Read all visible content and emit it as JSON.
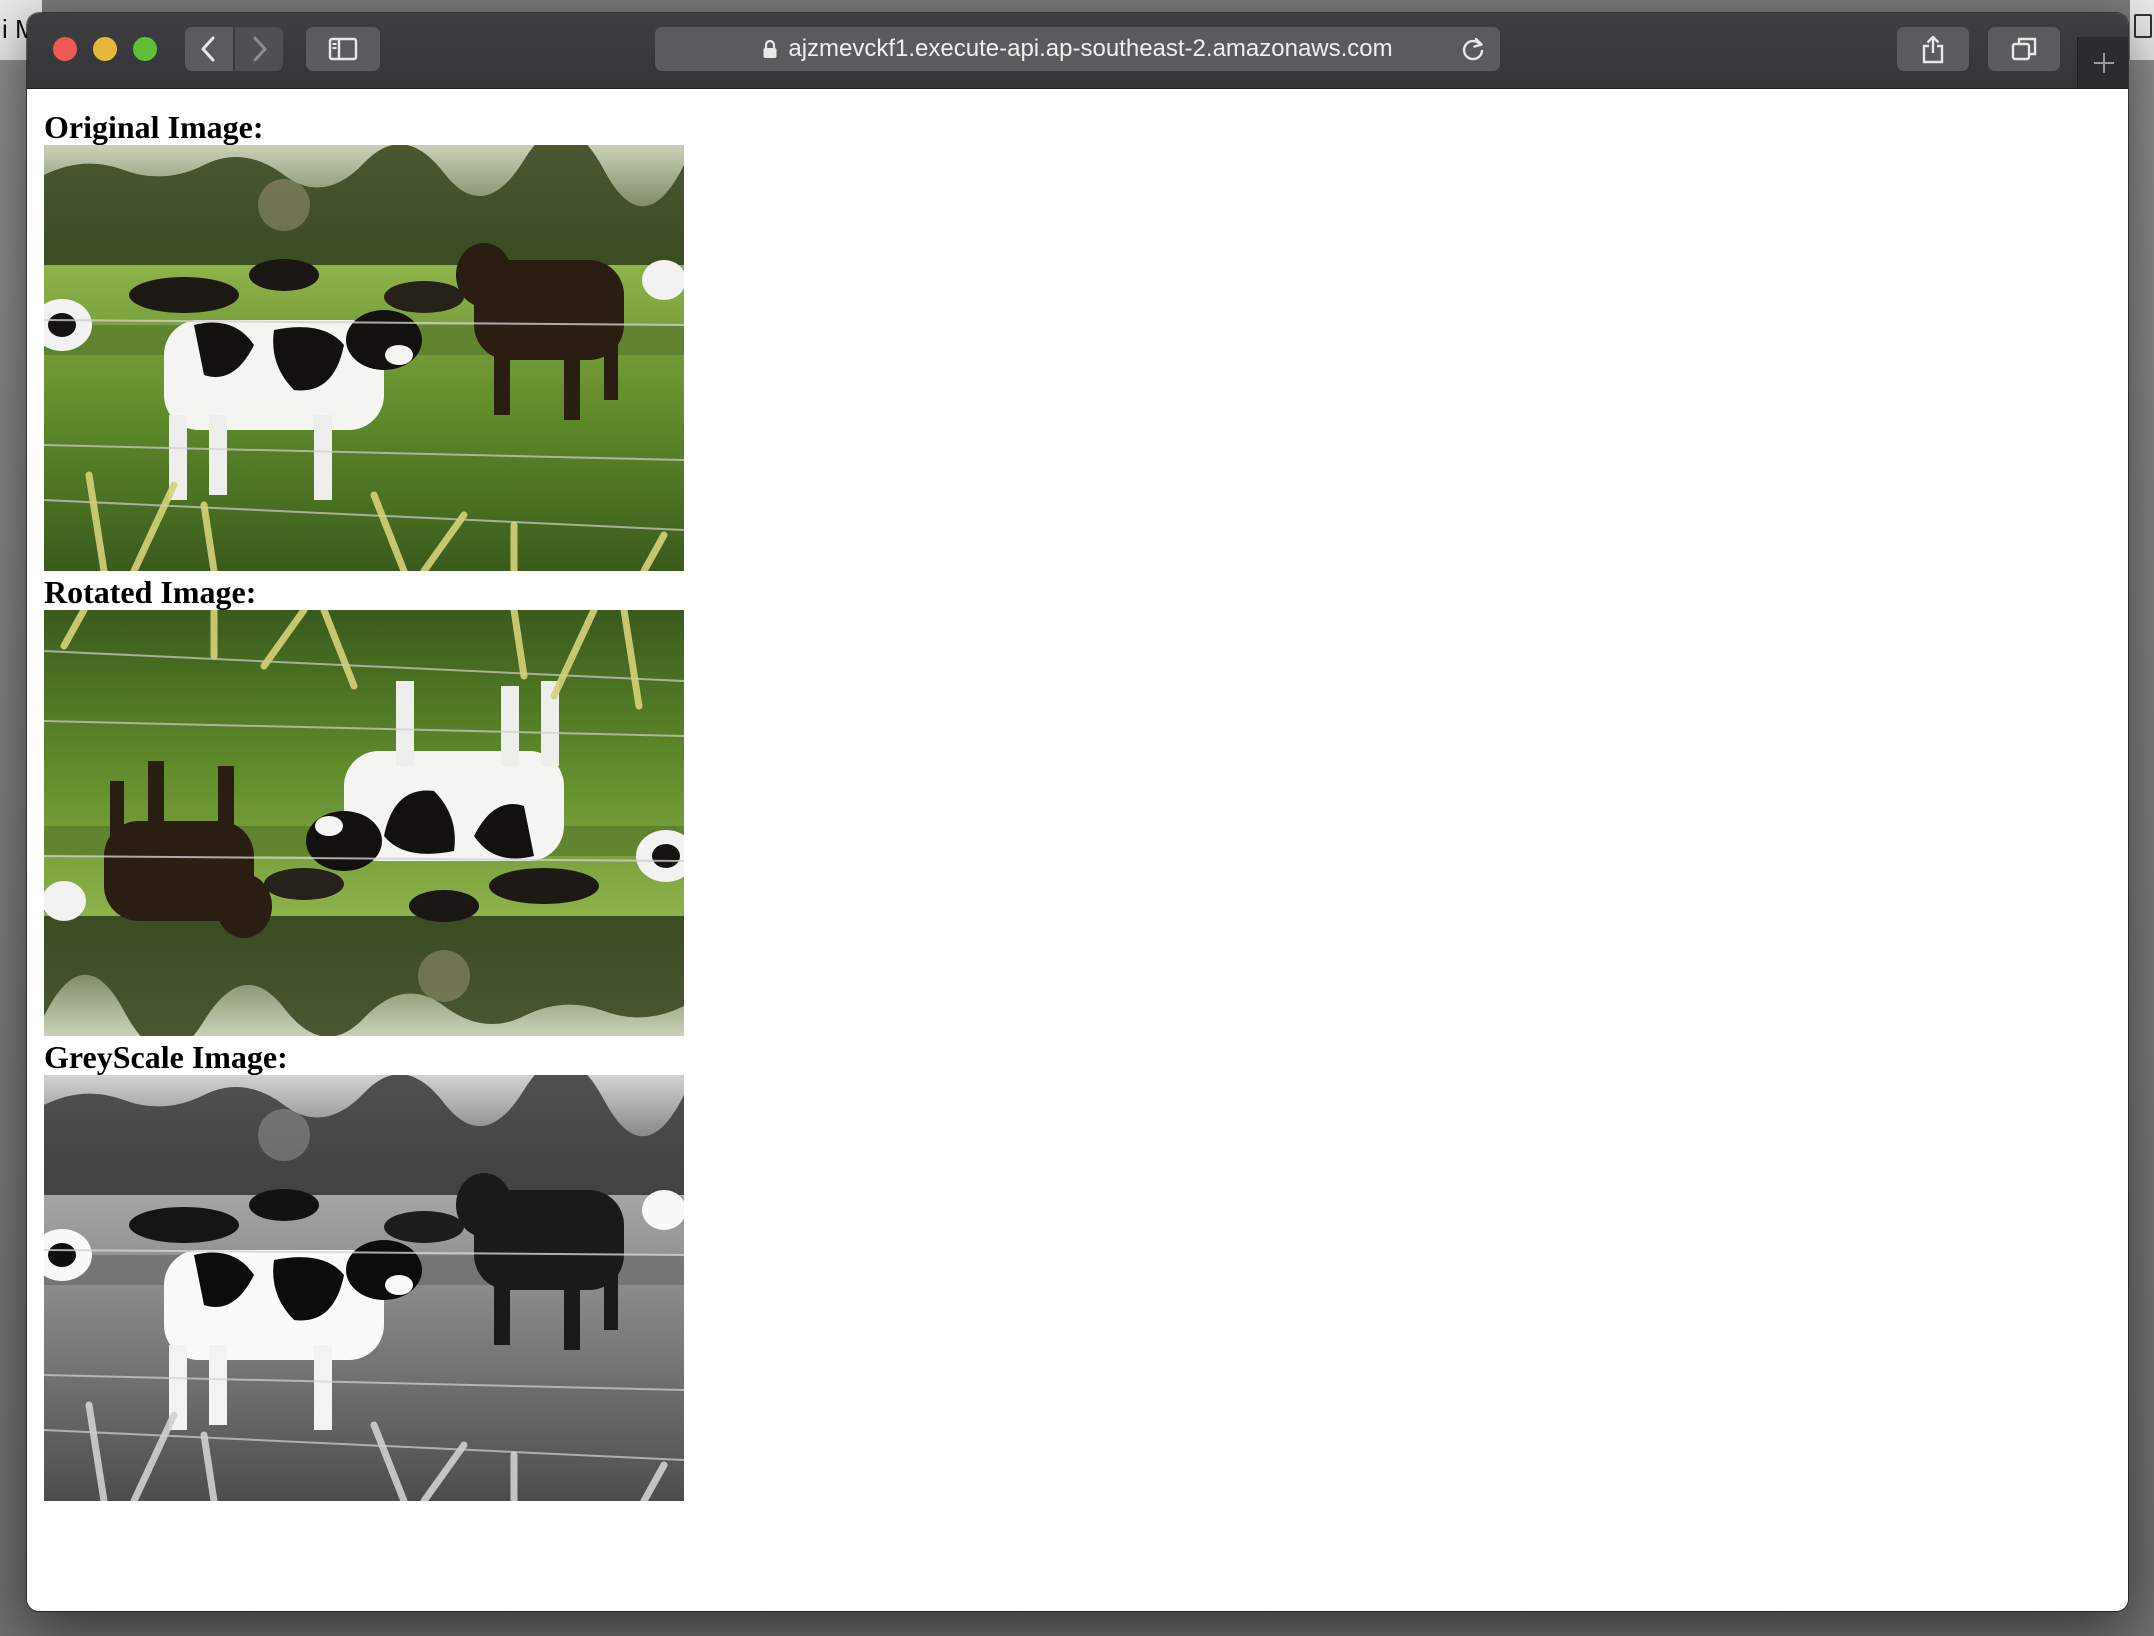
{
  "browser": {
    "url": "ajzmevckf1.execute-api.ap-southeast-2.amazonaws.com",
    "desktop_partial_text": "i M"
  },
  "page": {
    "sections": [
      {
        "title": "Original Image:"
      },
      {
        "title": "Rotated Image:"
      },
      {
        "title": "GreyScale Image:"
      }
    ]
  },
  "colors": {
    "toolbar": "#3a3a3c",
    "traffic_red": "#ee5a52",
    "traffic_yellow": "#e2b938",
    "traffic_green": "#5fc038"
  },
  "icons": [
    "lock-icon",
    "reload-icon",
    "back-icon",
    "forward-icon",
    "sidebar-icon",
    "share-icon",
    "tabs-icon",
    "plus-icon"
  ]
}
